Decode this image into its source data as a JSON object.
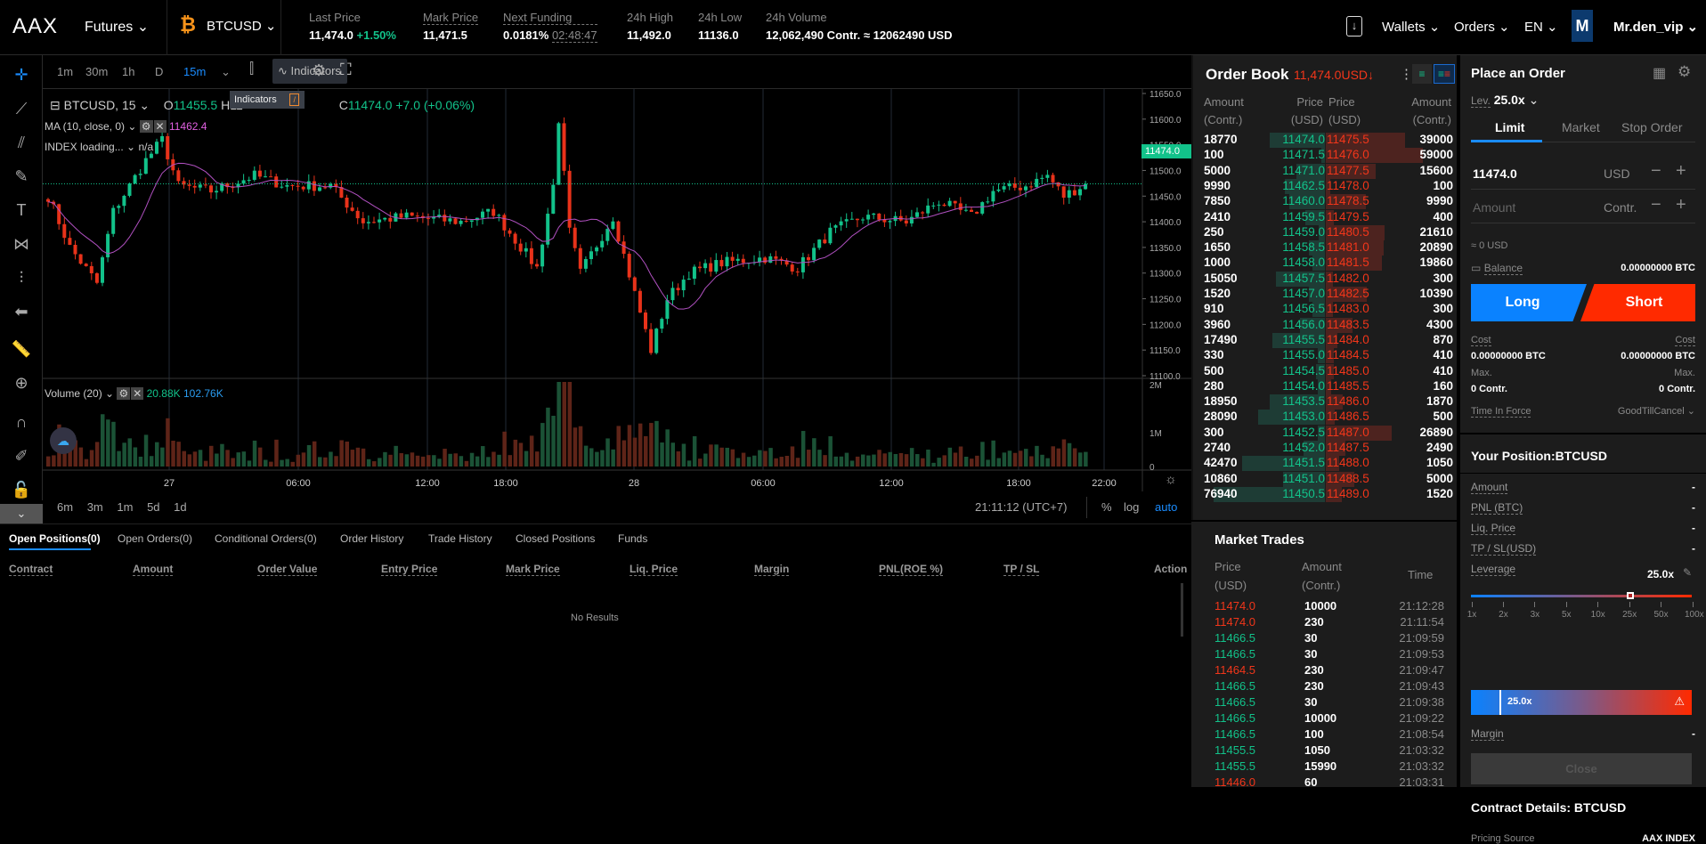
{
  "header": {
    "logo": "AAX",
    "product": "Futures",
    "symbol": "BTCUSD",
    "stats": [
      {
        "label": "Last Price",
        "value": "11,474.0",
        "change": "+1.50%"
      },
      {
        "label": "Mark Price",
        "value": "11,471.5"
      },
      {
        "label": "Next Funding",
        "value": "0.0181%",
        "countdown": "02:48:47"
      },
      {
        "label": "24h High",
        "value": "11,492.0"
      },
      {
        "label": "24h Low",
        "value": "11136.0"
      },
      {
        "label": "24h Volume",
        "value": "12,062,490 Contr. ≈ 12062490 USD"
      }
    ],
    "nav": {
      "wallets": "Wallets",
      "orders": "Orders",
      "lang": "EN",
      "avatar": "M",
      "user": "Mr.den_vip"
    }
  },
  "chart_toolbar": {
    "intervals": [
      "1m",
      "30m",
      "1h",
      "D",
      "15m"
    ],
    "active": "15m",
    "indicators": "Indicators",
    "tooltip": "Indicators",
    "tooltip_key": "/"
  },
  "chart": {
    "legend_symbol": "BTCUSD, 15",
    "o": "11455.5",
    "h": "H11",
    "c": "11474.0",
    "chg": "+7.0 (+0.06%)",
    "ma_label": "MA (10, close, 0)",
    "ma_value": "11462.4",
    "index_label": "INDEX loading...",
    "index_value": "n/a",
    "volume_label": "Volume (20)",
    "vol1": "20.88K",
    "vol2": "102.76K",
    "last_price_tag": "11474.0",
    "timezone": "21:11:12 (UTC+7)",
    "pct": "%",
    "log": "log",
    "auto": "auto",
    "ranges": [
      "6m",
      "3m",
      "1m",
      "5d",
      "1d"
    ]
  },
  "chart_data": {
    "type": "candlestick",
    "ylim": [
      11100,
      11650
    ],
    "yticks": [
      "11650.0",
      "11600.0",
      "11550.0",
      "11500.0",
      "11450.0",
      "11400.0",
      "11350.0",
      "11300.0",
      "11250.0",
      "11200.0",
      "11150.0",
      "11100.0"
    ],
    "volume_ticks": [
      "2M",
      "1M",
      "0"
    ],
    "xticks": [
      "27",
      "06:00",
      "12:00",
      "18:00",
      "28",
      "06:00",
      "12:00",
      "18:00",
      "22:00"
    ],
    "close_keypoints": [
      [
        0,
        11450
      ],
      [
        4,
        11350
      ],
      [
        9,
        11280
      ],
      [
        12,
        11420
      ],
      [
        18,
        11520
      ],
      [
        21,
        11560
      ],
      [
        24,
        11470
      ],
      [
        30,
        11460
      ],
      [
        38,
        11490
      ],
      [
        44,
        11470
      ],
      [
        52,
        11470
      ],
      [
        58,
        11400
      ],
      [
        66,
        11410
      ],
      [
        76,
        11400
      ],
      [
        82,
        11420
      ],
      [
        90,
        11310
      ],
      [
        93,
        11470
      ],
      [
        94,
        11600
      ],
      [
        96,
        11380
      ],
      [
        98,
        11300
      ],
      [
        104,
        11410
      ],
      [
        108,
        11260
      ],
      [
        111,
        11150
      ],
      [
        114,
        11250
      ],
      [
        118,
        11300
      ],
      [
        124,
        11320
      ],
      [
        132,
        11330
      ],
      [
        138,
        11310
      ],
      [
        144,
        11380
      ],
      [
        150,
        11410
      ],
      [
        158,
        11400
      ],
      [
        164,
        11440
      ],
      [
        170,
        11410
      ],
      [
        174,
        11460
      ],
      [
        180,
        11470
      ],
      [
        184,
        11490
      ],
      [
        187,
        11450
      ],
      [
        191,
        11474
      ]
    ]
  },
  "orderbook": {
    "title": "Order Book",
    "price": "11,474.0USD↓",
    "h_amount": "Amount",
    "h_contr": "(Contr.)",
    "h_price": "Price",
    "h_usd": "(USD)",
    "rows": [
      [
        "18770",
        "11474.0",
        "11475.5",
        "39000"
      ],
      [
        "100",
        "11471.5",
        "11476.0",
        "59000"
      ],
      [
        "5000",
        "11471.0",
        "11477.5",
        "15600"
      ],
      [
        "9990",
        "11462.5",
        "11478.0",
        "100"
      ],
      [
        "7850",
        "11460.0",
        "11478.5",
        "9990"
      ],
      [
        "2410",
        "11459.5",
        "11479.5",
        "400"
      ],
      [
        "250",
        "11459.0",
        "11480.5",
        "21610"
      ],
      [
        "1650",
        "11458.5",
        "11481.0",
        "20890"
      ],
      [
        "1000",
        "11458.0",
        "11481.5",
        "19860"
      ],
      [
        "15050",
        "11457.5",
        "11482.0",
        "300"
      ],
      [
        "1520",
        "11457.0",
        "11482.5",
        "10390"
      ],
      [
        "910",
        "11456.5",
        "11483.0",
        "300"
      ],
      [
        "3960",
        "11456.0",
        "11483.5",
        "4300"
      ],
      [
        "17490",
        "11455.5",
        "11484.0",
        "870"
      ],
      [
        "330",
        "11455.0",
        "11484.5",
        "410"
      ],
      [
        "500",
        "11454.5",
        "11485.0",
        "410"
      ],
      [
        "280",
        "11454.0",
        "11485.5",
        "160"
      ],
      [
        "18950",
        "11453.5",
        "11486.0",
        "1870"
      ],
      [
        "28090",
        "11453.0",
        "11486.5",
        "500"
      ],
      [
        "300",
        "11452.5",
        "11487.0",
        "26890"
      ],
      [
        "2740",
        "11452.0",
        "11487.5",
        "2490"
      ],
      [
        "42470",
        "11451.5",
        "11488.0",
        "1050"
      ],
      [
        "10860",
        "11451.0",
        "11488.5",
        "5000"
      ],
      [
        "76940",
        "11450.5",
        "11489.0",
        "1520"
      ]
    ]
  },
  "trades": {
    "title": "Market Trades",
    "h_price": "Price",
    "h_usd": "(USD)",
    "h_amount": "Amount",
    "h_contr": "(Contr.)",
    "h_time": "Time",
    "rows": [
      [
        "11474.0",
        "10000",
        "21:12:28",
        "sell"
      ],
      [
        "11474.0",
        "230",
        "21:11:54",
        "sell"
      ],
      [
        "11466.5",
        "30",
        "21:09:59",
        "buy"
      ],
      [
        "11466.5",
        "30",
        "21:09:53",
        "buy"
      ],
      [
        "11464.5",
        "230",
        "21:09:47",
        "sell"
      ],
      [
        "11466.5",
        "230",
        "21:09:43",
        "buy"
      ],
      [
        "11466.5",
        "30",
        "21:09:38",
        "buy"
      ],
      [
        "11466.5",
        "10000",
        "21:09:22",
        "buy"
      ],
      [
        "11466.5",
        "100",
        "21:08:54",
        "buy"
      ],
      [
        "11455.5",
        "1050",
        "21:03:32",
        "buy"
      ],
      [
        "11455.5",
        "15990",
        "21:03:32",
        "buy"
      ],
      [
        "11446.0",
        "60",
        "21:03:31",
        "sell"
      ]
    ]
  },
  "order": {
    "title": "Place an Order",
    "lev_label": "Lev.",
    "lev": "25.0x",
    "tabs": [
      "Limit",
      "Market",
      "Stop Order"
    ],
    "price": "11474.0",
    "price_unit": "USD",
    "amount_placeholder": "Amount",
    "amount_unit": "Contr.",
    "approx": "≈ 0  USD",
    "balance_label": "Balance",
    "balance": "0.00000000 BTC",
    "long": "Long",
    "short": "Short",
    "cost": "Cost",
    "cost_long": "0.00000000 BTC",
    "cost_short": "0.00000000 BTC",
    "max": "Max.",
    "max_long": "0 Contr.",
    "max_short": "0 Contr.",
    "tif_label": "Time In Force",
    "tif": "GoodTillCancel"
  },
  "position": {
    "title": "Your Position:BTCUSD",
    "amount": "Amount",
    "pnl": "PNL (BTC)",
    "liq": "Liq. Price",
    "tpsl": "TP / SL(USD)",
    "leverage": "Leverage",
    "lev_value": "25.0x",
    "dash": "-",
    "ticks": [
      "1x",
      "2x",
      "3x",
      "5x",
      "10x",
      "25x",
      "50x",
      "100x"
    ],
    "slider_value": 0.72,
    "bar_label": "25.0x",
    "margin": "Margin",
    "close": "Close",
    "contract_title": "Contract Details: BTCUSD",
    "pricing_source": "Pricing Source",
    "pricing_value": "AAX INDEX"
  },
  "bottom": {
    "tabs": [
      "Open Positions(0)",
      "Open Orders(0)",
      "Conditional Orders(0)",
      "Order History",
      "Trade History",
      "Closed Positions",
      "Funds"
    ],
    "columns": [
      "Contract",
      "Amount",
      "Order Value",
      "Entry Price",
      "Mark Price",
      "Liq. Price",
      "Margin",
      "PNL(ROE %)",
      "TP / SL",
      "Action"
    ],
    "empty": "No Results"
  },
  "colors": {
    "up": "#12c28a",
    "down": "#f2361a",
    "accent": "#1a8cff"
  }
}
